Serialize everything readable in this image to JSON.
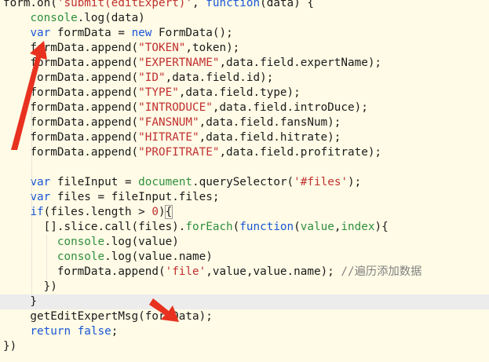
{
  "editor": {
    "lines": [
      [
        {
          "c": "txt",
          "t": "form.on("
        },
        {
          "c": "str",
          "t": "'submit(editExpert)'"
        },
        {
          "c": "txt",
          "t": ", "
        },
        {
          "c": "kw",
          "t": "function"
        },
        {
          "c": "txt",
          "t": "(data) {"
        }
      ],
      [
        {
          "c": "txt",
          "t": "    "
        },
        {
          "c": "fn",
          "t": "console"
        },
        {
          "c": "txt",
          "t": ".log(data)"
        }
      ],
      [
        {
          "c": "txt",
          "t": "    "
        },
        {
          "c": "kw",
          "t": "var"
        },
        {
          "c": "txt",
          "t": " formData = "
        },
        {
          "c": "kw",
          "t": "new"
        },
        {
          "c": "txt",
          "t": " FormData();"
        }
      ],
      [
        {
          "c": "txt",
          "t": "    formData.append("
        },
        {
          "c": "str",
          "t": "\"TOKEN\""
        },
        {
          "c": "txt",
          "t": ",token);"
        }
      ],
      [
        {
          "c": "txt",
          "t": "    formData.append("
        },
        {
          "c": "str",
          "t": "\"EXPERTNAME\""
        },
        {
          "c": "txt",
          "t": ",data.field.expertName);"
        }
      ],
      [
        {
          "c": "txt",
          "t": "    formData.append("
        },
        {
          "c": "str",
          "t": "\"ID\""
        },
        {
          "c": "txt",
          "t": ",data.field.id);"
        }
      ],
      [
        {
          "c": "txt",
          "t": "    formData.append("
        },
        {
          "c": "str",
          "t": "\"TYPE\""
        },
        {
          "c": "txt",
          "t": ",data.field.type);"
        }
      ],
      [
        {
          "c": "txt",
          "t": "    formData.append("
        },
        {
          "c": "str",
          "t": "\"INTRODUCE\""
        },
        {
          "c": "txt",
          "t": ",data.field.introDuce);"
        }
      ],
      [
        {
          "c": "txt",
          "t": "    formData.append("
        },
        {
          "c": "str",
          "t": "\"FANSNUM\""
        },
        {
          "c": "txt",
          "t": ",data.field.fansNum);"
        }
      ],
      [
        {
          "c": "txt",
          "t": "    formData.append("
        },
        {
          "c": "str",
          "t": "\"HITRATE\""
        },
        {
          "c": "txt",
          "t": ",data.field.hitrate);"
        }
      ],
      [
        {
          "c": "txt",
          "t": "    formData.append("
        },
        {
          "c": "str",
          "t": "\"PROFITRATE\""
        },
        {
          "c": "txt",
          "t": ",data.field.profitrate);"
        }
      ],
      [],
      [
        {
          "c": "txt",
          "t": "    "
        },
        {
          "c": "kw",
          "t": "var"
        },
        {
          "c": "txt",
          "t": " fileInput = "
        },
        {
          "c": "fn",
          "t": "document"
        },
        {
          "c": "txt",
          "t": ".querySelector("
        },
        {
          "c": "str",
          "t": "'#files'"
        },
        {
          "c": "txt",
          "t": ");"
        }
      ],
      [
        {
          "c": "txt",
          "t": "    "
        },
        {
          "c": "kw",
          "t": "var"
        },
        {
          "c": "txt",
          "t": " files = fileInput.files;"
        }
      ],
      [
        {
          "c": "txt",
          "t": "    "
        },
        {
          "c": "kw",
          "t": "if"
        },
        {
          "c": "txt",
          "t": "(files.length > "
        },
        {
          "c": "num",
          "t": "0"
        },
        {
          "c": "txt",
          "t": ")"
        },
        {
          "c": "txt",
          "t": "{",
          "hl": true
        }
      ],
      [
        {
          "c": "txt",
          "t": "      [].slice.call(files)."
        },
        {
          "c": "fn",
          "t": "forEach"
        },
        {
          "c": "txt",
          "t": "("
        },
        {
          "c": "kw",
          "t": "function"
        },
        {
          "c": "txt",
          "t": "("
        },
        {
          "c": "fn",
          "t": "value"
        },
        {
          "c": "txt",
          "t": ","
        },
        {
          "c": "fn",
          "t": "index"
        },
        {
          "c": "txt",
          "t": "){"
        }
      ],
      [
        {
          "c": "txt",
          "t": "        "
        },
        {
          "c": "fn",
          "t": "console"
        },
        {
          "c": "txt",
          "t": ".log(value)"
        }
      ],
      [
        {
          "c": "txt",
          "t": "        "
        },
        {
          "c": "fn",
          "t": "console"
        },
        {
          "c": "txt",
          "t": ".log(value.name)"
        }
      ],
      [
        {
          "c": "txt",
          "t": "        formData.append("
        },
        {
          "c": "str",
          "t": "'file'"
        },
        {
          "c": "txt",
          "t": ",value,value.name); "
        },
        {
          "c": "cm",
          "t": "//遍历添加数据"
        }
      ],
      [
        {
          "c": "txt",
          "t": "      })"
        }
      ],
      [
        {
          "c": "txt",
          "t": "    }"
        }
      ],
      [
        {
          "c": "txt",
          "t": "    getEditExpertMsg(formData);"
        }
      ],
      [
        {
          "c": "txt",
          "t": "    "
        },
        {
          "c": "kw",
          "t": "return"
        },
        {
          "c": "txt",
          "t": " "
        },
        {
          "c": "kw",
          "t": "false"
        },
        {
          "c": "txt",
          "t": ";"
        }
      ],
      [
        {
          "c": "txt",
          "t": "})"
        }
      ]
    ],
    "highlighted_line": 20,
    "arrow_color": "#e8311f"
  }
}
